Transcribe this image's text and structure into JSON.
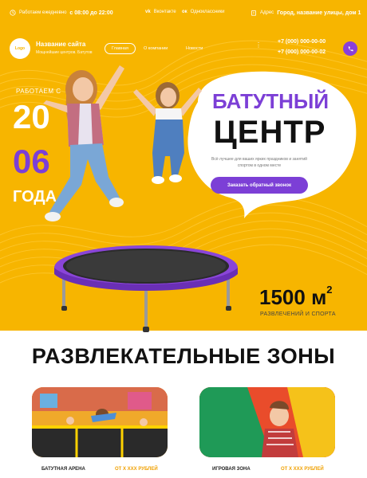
{
  "topbar": {
    "hours_label": "Работаем ежедневно",
    "hours_value": "с 08:00 до 22:00",
    "vk": "Вконтакте",
    "ok": "Одноклассники",
    "address_label": "Адрес",
    "address_value": "Город, название улицы, дом 1"
  },
  "header": {
    "logo_text": "Logo",
    "site_name": "Название сайта",
    "site_sub": "Мощнейшие центров. Батутов",
    "nav": [
      "Главная",
      "О компании",
      "Новости"
    ],
    "nav_more": "⋮",
    "phones": [
      "+7 (000) 000-00-00",
      "+7 (000) 000-00-02"
    ]
  },
  "hero": {
    "since": "РАБОТАЕМ С",
    "year_top": "20",
    "year_bottom": "06",
    "year_word": "ГОДА",
    "title_1": "БАТУТНЫЙ",
    "title_2": "ЦЕНТР",
    "description": "Всё лучшее для ваших ярких праздников и занятий спортом в одном месте",
    "cta": "Заказать обратный звонок",
    "area_value": "1500 м",
    "area_sup": "2",
    "area_label": "РАЗВЛЕЧЕНИЙ И СПОРТА"
  },
  "zones": {
    "title": "РАЗВЛЕКАТЕЛЬНЫЕ ЗОНЫ",
    "cards": [
      {
        "name": "БАТУТНАЯ АРЕНА",
        "price": "ОТ Х ХХХ РУБЛЕЙ"
      },
      {
        "name": "ИГРОВАЯ ЗОНА",
        "price": "ОТ Х ХХХ РУБЛЕЙ"
      }
    ]
  },
  "colors": {
    "accent_yellow": "#f7b500",
    "accent_purple": "#7c3fd6"
  }
}
